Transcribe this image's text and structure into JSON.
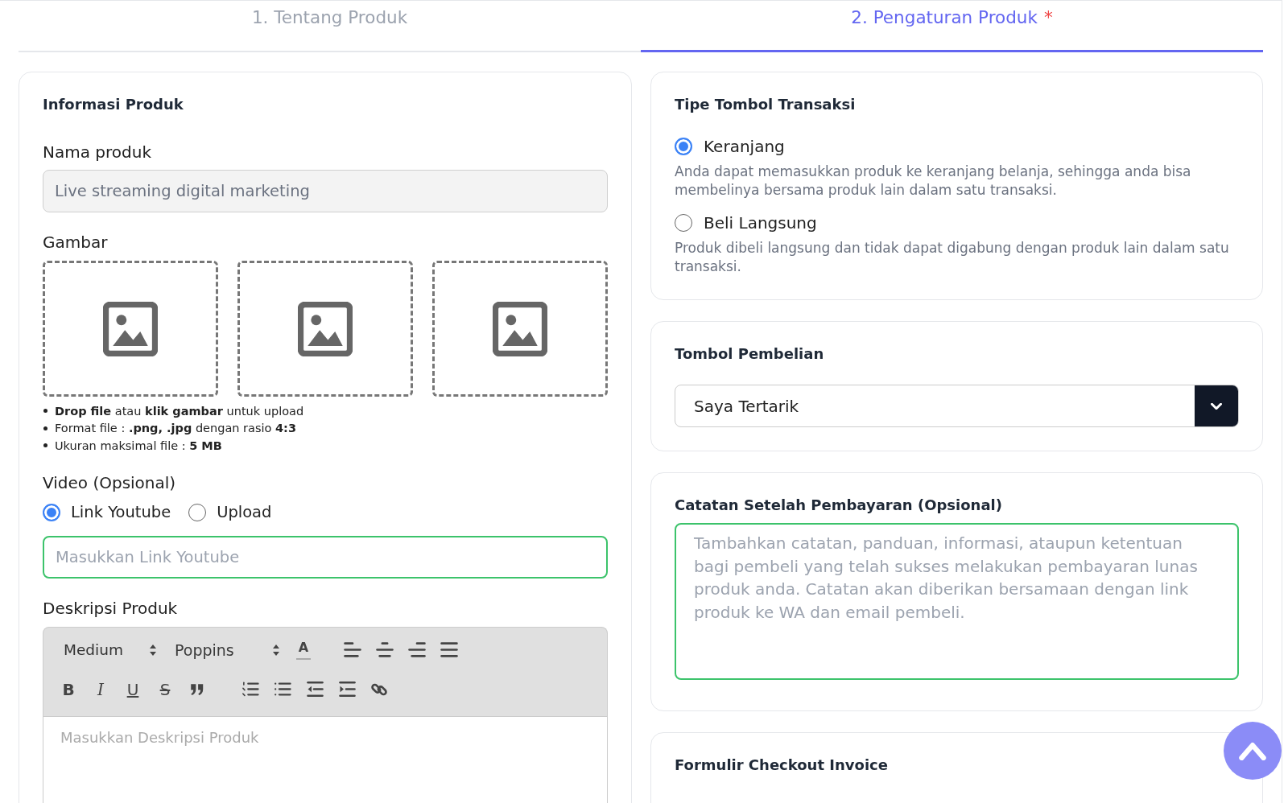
{
  "tabs": [
    {
      "label": "1. Tentang Produk",
      "selected": false
    },
    {
      "label": "2. Pengaturan Produk",
      "selected": true,
      "required_mark": "*"
    }
  ],
  "product_info": {
    "title": "Informasi Produk",
    "name_field": {
      "label": "Nama produk",
      "value": "Live streaming digital marketing",
      "disabled": true
    },
    "images": {
      "label": "Gambar",
      "slots": [
        {
          "filled": false
        },
        {
          "filled": false
        },
        {
          "filled": false
        }
      ],
      "hints": [
        "**Drop file** atau **klik gambar** untuk upload",
        "Format file : **.png, .jpg** dengan rasio **4:3**",
        "Ukuran maksimal file : **5 MB**"
      ]
    },
    "video": {
      "label": "Video (Opsional)",
      "options": [
        {
          "label": "Link Youtube",
          "selected": true
        },
        {
          "label": "Upload",
          "selected": false
        }
      ],
      "link_field": {
        "placeholder": "Masukkan Link Youtube",
        "valid": true
      }
    },
    "description": {
      "label": "Deskripsi Produk",
      "toolbar": {
        "size": "Medium",
        "font": "Poppins",
        "color_glyph": "A",
        "format_buttons": [
          {
            "kind": "bold",
            "glyph": "B"
          },
          {
            "kind": "italic",
            "glyph": "I"
          },
          {
            "kind": "underline",
            "glyph": "U"
          },
          {
            "kind": "strike",
            "glyph": "S"
          }
        ]
      },
      "placeholder": "Masukkan Deskripsi Produk"
    }
  },
  "transaction_type": {
    "title": "Tipe Tombol Transaksi",
    "options": [
      {
        "label": "Keranjang",
        "description": "Anda dapat memasukkan produk ke keranjang belanja, sehingga anda bisa membelinya bersama produk lain dalam satu transaksi.",
        "selected": true
      },
      {
        "label": "Beli Langsung",
        "description": "Produk dibeli langsung dan tidak dapat digabung dengan produk lain dalam satu transaksi.",
        "selected": false
      }
    ]
  },
  "purchase_button": {
    "title": "Tombol Pembelian",
    "value": "Saya Tertarik"
  },
  "post_payment_note": {
    "title": "Catatan Setelah Pembayaran (Opsional)",
    "placeholder": "Tambahkan catatan, panduan, informasi, ataupun ketentuan bagi pembeli yang telah sukses melakukan pembayaran lunas produk anda. Catatan akan diberikan bersamaan dengan link produk ke WA dan email pembeli.",
    "valid": true
  },
  "checkout_form": {
    "title": "Formulir Checkout Invoice"
  }
}
